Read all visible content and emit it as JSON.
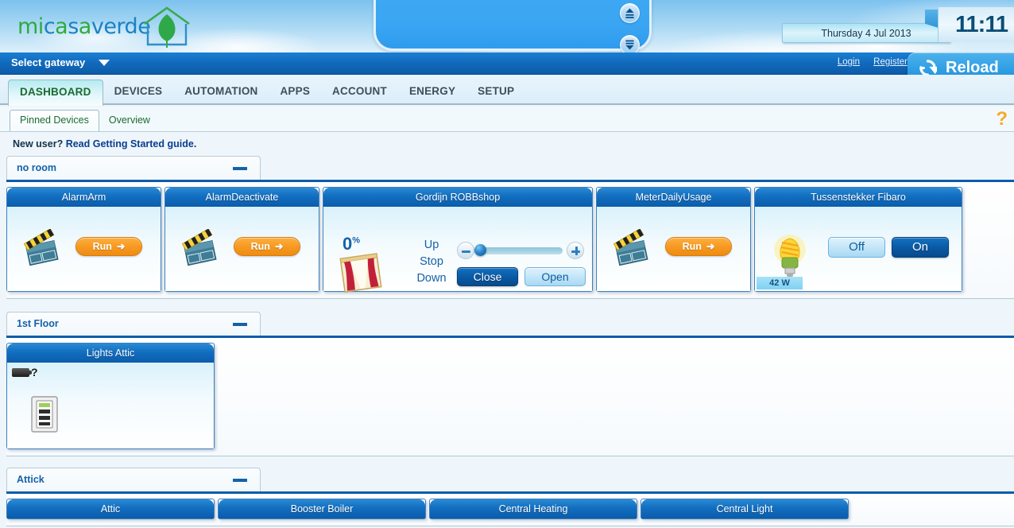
{
  "brand": {
    "name_part1": "mi",
    "name_part2": "c",
    "name_part3": "a",
    "name_part4": "s",
    "name_part5": "a",
    "name_part6": "verde",
    "full_name": "micasaverde",
    "house_leaf_icon": "house-leaf-logo"
  },
  "header": {
    "date": "Thursday 4 Jul 2013",
    "time": "11:11",
    "eject_up_icon": "eject-up-icon",
    "eject_down_icon": "eject-down-icon"
  },
  "gateway_bar": {
    "label": "Select gateway",
    "chevron_icon": "chevron-down-icon",
    "login": "Login",
    "register": "Register",
    "reload": "Reload",
    "reload_icon": "refresh-icon"
  },
  "nav_tabs": [
    {
      "label": "DASHBOARD",
      "active": true
    },
    {
      "label": "DEVICES",
      "active": false
    },
    {
      "label": "AUTOMATION",
      "active": false
    },
    {
      "label": "APPS",
      "active": false
    },
    {
      "label": "ACCOUNT",
      "active": false
    },
    {
      "label": "ENERGY",
      "active": false
    },
    {
      "label": "SETUP",
      "active": false
    }
  ],
  "sub_tabs": [
    {
      "label": "Pinned Devices",
      "active": true
    },
    {
      "label": "Overview",
      "active": false
    }
  ],
  "help_icon": "?",
  "new_user": {
    "prefix": "New user? ",
    "link": "Read Getting Started guide",
    "suffix": "."
  },
  "rooms": [
    {
      "name": "no room",
      "minimize_icon": "minimize-icon",
      "devices": [
        {
          "title": "AlarmArm",
          "type": "scene",
          "icon": "clapperboard-icon",
          "run_label": "Run",
          "run_arrow": "➜"
        },
        {
          "title": "AlarmDeactivate",
          "type": "scene",
          "icon": "clapperboard-icon",
          "run_label": "Run",
          "run_arrow": "➜"
        },
        {
          "title": "Gordijn ROBBshop",
          "type": "window-covering",
          "icon": "curtain-icon",
          "percent": "0",
          "percent_unit": "%",
          "up_label": "Up",
          "stop_label": "Stop",
          "down_label": "Down",
          "slider_value": 0,
          "slider_minus_icon": "minus-icon",
          "slider_plus_icon": "plus-icon",
          "close_label": "Close",
          "open_label": "Open"
        },
        {
          "title": "MeterDailyUsage",
          "type": "scene",
          "icon": "clapperboard-icon",
          "run_label": "Run",
          "run_arrow": "➜"
        },
        {
          "title": "Tussenstekker Fibaro",
          "type": "switch",
          "icon": "lightbulb-icon",
          "power": "42 W",
          "off_label": "Off",
          "on_label": "On",
          "state": "on"
        }
      ]
    },
    {
      "name": "1st Floor",
      "minimize_icon": "minimize-icon",
      "devices": [
        {
          "title": "Lights Attic",
          "type": "dimmer",
          "icon": "wall-switch-icon",
          "battery_icon": "battery-icon",
          "battery_value": "?"
        }
      ]
    },
    {
      "name": "Attick",
      "minimize_icon": "minimize-icon",
      "devices": [
        {
          "title": "Attic",
          "type": "device",
          "icon": "device-icon"
        },
        {
          "title": "Booster Boiler",
          "type": "device",
          "icon": "device-icon"
        },
        {
          "title": "Central Heating",
          "type": "device",
          "icon": "device-icon"
        },
        {
          "title": "Central Light",
          "type": "device",
          "icon": "device-icon"
        }
      ]
    }
  ],
  "colors": {
    "brand_green": "#2eab3c",
    "brand_blue": "#1a82c4",
    "header_blue": "#0c5ca9",
    "card_header_blue": "#126ec0",
    "accent_orange": "#f79a22",
    "help_orange": "#f9a825",
    "sky_blue": "#7dc2ef"
  }
}
